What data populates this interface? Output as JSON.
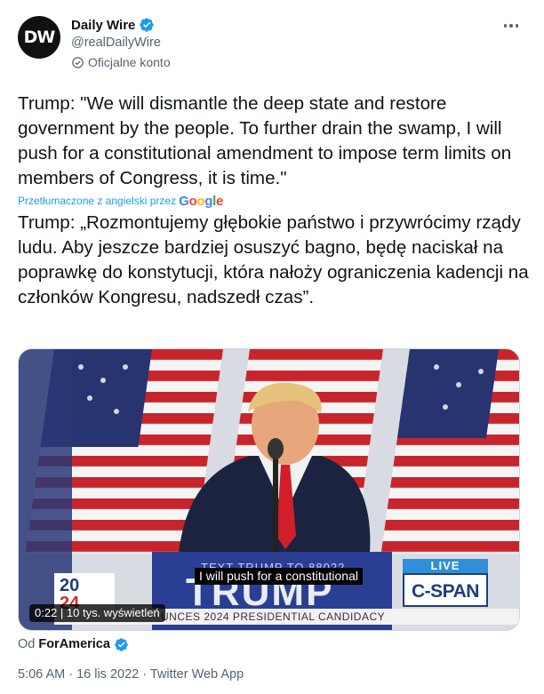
{
  "account": {
    "avatar_text": "DW",
    "display_name": "Daily Wire",
    "handle": "@realDailyWire",
    "official_label": "Oficjalne konto"
  },
  "tweet": {
    "text": "Trump: \"We will dismantle the deep state and restore government by the people. To further drain the swamp, I will push for a constitutional amendment to impose term limits on members of Congress, it is time.\"",
    "translated_label": "Przetłumaczone z angielski przez",
    "translation_provider": "Google",
    "translation": "Trump: „Rozmontujemy głębokie państwo i przywrócimy rządy ludu. Aby jeszcze bardziej osuszyć bagno, będę naciskał na poprawkę do konstytucji, która nałoży ograniczenia kadencji na członków Kongresu, nadszedł czas”."
  },
  "video": {
    "caption": "I will push for a constitutional",
    "time_views": "0:22 | 10 tys. wyświetleń",
    "podium_text": "TRUMP",
    "podium_small": "TEXT TRUMP TO 88022",
    "logo_2024_top": "20",
    "logo_2024_bottom": "24",
    "live_label": "LIVE",
    "network": "C-SPAN",
    "lower_third": "UNCES 2024 PRESIDENTIAL CANDIDACY"
  },
  "via": {
    "prefix": "Od",
    "source": "ForAmerica"
  },
  "meta": "5:06 AM · 16 lis 2022 · Twitter Web App",
  "colors": {
    "accent": "#1d9bf0",
    "secondary_text": "#536471",
    "primary_text": "#0f1419"
  },
  "icons": [
    "verified-badge-icon",
    "official-account-icon",
    "more-icon"
  ]
}
